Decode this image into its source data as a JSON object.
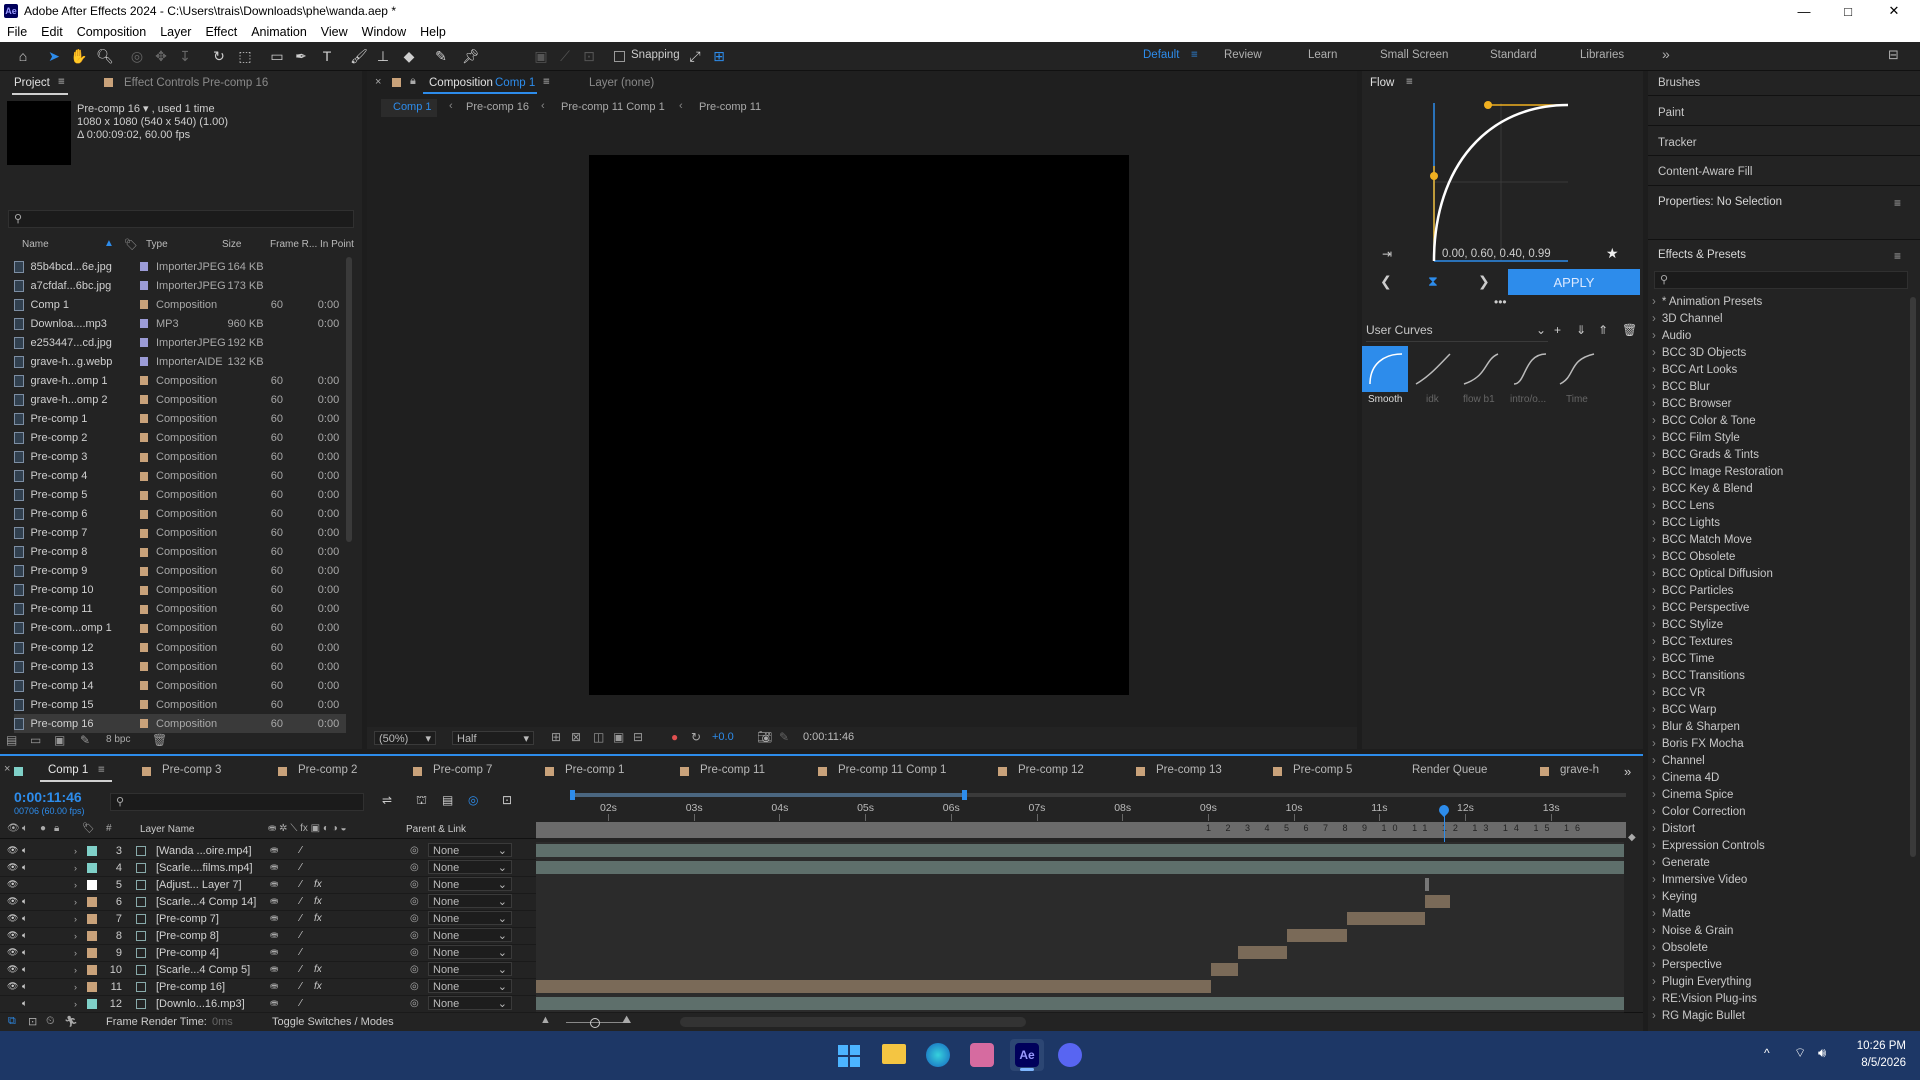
{
  "window": {
    "title": "Adobe After Effects 2024 - C:\\Users\\trais\\Downloads\\phe\\wanda.aep *",
    "controls": [
      "—",
      "□",
      "✕"
    ]
  },
  "menu": [
    "File",
    "Edit",
    "Composition",
    "Layer",
    "Effect",
    "Animation",
    "View",
    "Window",
    "Help"
  ],
  "toolbar": {
    "snapping_label": "Snapping",
    "workspaces": [
      "Default",
      "Review",
      "Learn",
      "Small Screen",
      "Standard",
      "Libraries"
    ],
    "active_workspace": "Default"
  },
  "project": {
    "tab": "Project",
    "effect_controls_tab": "Effect Controls Pre-comp 16",
    "info_name": "Pre-comp 16 ▾ , used 1 time",
    "info_dims": "1080 x 1080  (540 x 540) (1.00)",
    "info_dur": "Δ 0:00:09:02, 60.00 fps",
    "columns": [
      "Name",
      "Type",
      "Size",
      "Frame R...",
      "In Point"
    ],
    "rows": [
      {
        "name": "85b4bcd...6e.jpg",
        "type": "ImporterJPEG",
        "size": "164 KB",
        "fr": "",
        "ip": "",
        "color": "#9b9bd6"
      },
      {
        "name": "a7cfdaf...6bc.jpg",
        "type": "ImporterJPEG",
        "size": "173 KB",
        "fr": "",
        "ip": "",
        "color": "#9b9bd6"
      },
      {
        "name": "Comp 1",
        "type": "Composition",
        "size": "",
        "fr": "60",
        "ip": "0:00",
        "color": "#c9a27a"
      },
      {
        "name": "Downloa....mp3",
        "type": "MP3",
        "size": "960 KB",
        "fr": "",
        "ip": "0:00",
        "color": "#9b9bd6"
      },
      {
        "name": "e253447...cd.jpg",
        "type": "ImporterJPEG",
        "size": "192 KB",
        "fr": "",
        "ip": "",
        "color": "#9b9bd6"
      },
      {
        "name": "grave-h...g.webp",
        "type": "ImporterAIDE",
        "size": "132 KB",
        "fr": "",
        "ip": "",
        "color": "#9b9bd6"
      },
      {
        "name": "grave-h...omp 1",
        "type": "Composition",
        "size": "",
        "fr": "60",
        "ip": "0:00",
        "color": "#c9a27a"
      },
      {
        "name": "grave-h...omp 2",
        "type": "Composition",
        "size": "",
        "fr": "60",
        "ip": "0:00",
        "color": "#c9a27a"
      },
      {
        "name": "Pre-comp 1",
        "type": "Composition",
        "size": "",
        "fr": "60",
        "ip": "0:00",
        "color": "#c9a27a"
      },
      {
        "name": "Pre-comp 2",
        "type": "Composition",
        "size": "",
        "fr": "60",
        "ip": "0:00",
        "color": "#c9a27a"
      },
      {
        "name": "Pre-comp 3",
        "type": "Composition",
        "size": "",
        "fr": "60",
        "ip": "0:00",
        "color": "#c9a27a"
      },
      {
        "name": "Pre-comp 4",
        "type": "Composition",
        "size": "",
        "fr": "60",
        "ip": "0:00",
        "color": "#c9a27a"
      },
      {
        "name": "Pre-comp 5",
        "type": "Composition",
        "size": "",
        "fr": "60",
        "ip": "0:00",
        "color": "#c9a27a"
      },
      {
        "name": "Pre-comp 6",
        "type": "Composition",
        "size": "",
        "fr": "60",
        "ip": "0:00",
        "color": "#c9a27a"
      },
      {
        "name": "Pre-comp 7",
        "type": "Composition",
        "size": "",
        "fr": "60",
        "ip": "0:00",
        "color": "#c9a27a"
      },
      {
        "name": "Pre-comp 8",
        "type": "Composition",
        "size": "",
        "fr": "60",
        "ip": "0:00",
        "color": "#c9a27a"
      },
      {
        "name": "Pre-comp 9",
        "type": "Composition",
        "size": "",
        "fr": "60",
        "ip": "0:00",
        "color": "#c9a27a"
      },
      {
        "name": "Pre-comp 10",
        "type": "Composition",
        "size": "",
        "fr": "60",
        "ip": "0:00",
        "color": "#c9a27a"
      },
      {
        "name": "Pre-comp 11",
        "type": "Composition",
        "size": "",
        "fr": "60",
        "ip": "0:00",
        "color": "#c9a27a"
      },
      {
        "name": "Pre-com...omp 1",
        "type": "Composition",
        "size": "",
        "fr": "60",
        "ip": "0:00",
        "color": "#c9a27a"
      },
      {
        "name": "Pre-comp 12",
        "type": "Composition",
        "size": "",
        "fr": "60",
        "ip": "0:00",
        "color": "#c9a27a"
      },
      {
        "name": "Pre-comp 13",
        "type": "Composition",
        "size": "",
        "fr": "60",
        "ip": "0:00",
        "color": "#c9a27a"
      },
      {
        "name": "Pre-comp 14",
        "type": "Composition",
        "size": "",
        "fr": "60",
        "ip": "0:00",
        "color": "#c9a27a"
      },
      {
        "name": "Pre-comp 15",
        "type": "Composition",
        "size": "",
        "fr": "60",
        "ip": "0:00",
        "color": "#c9a27a"
      },
      {
        "name": "Pre-comp 16",
        "type": "Composition",
        "size": "",
        "fr": "60",
        "ip": "0:00",
        "color": "#c9a27a"
      }
    ],
    "bpc": "8 bpc"
  },
  "comp": {
    "tab_label": "Composition",
    "tab_comp": "Comp 1",
    "layer_tab": "Layer (none)",
    "breadcrumbs": [
      "Comp 1",
      "Pre-comp 16",
      "Pre-comp 11 Comp 1",
      "Pre-comp 11"
    ],
    "zoom": "(50%)",
    "resolution": "Half",
    "exposure": "+0.0",
    "timecode": "0:00:11:46"
  },
  "flow": {
    "title": "Flow",
    "values": "0.00, 0.60, 0.40, 0.99",
    "apply": "APPLY",
    "curves_select": "User Curves",
    "presets": [
      "Smooth",
      "idk",
      "flow b1",
      "intro/o...",
      "Time"
    ]
  },
  "right_panels": [
    "Brushes",
    "Paint",
    "Tracker",
    "Content-Aware Fill",
    "Properties: No Selection",
    "Effects & Presets"
  ],
  "effects": [
    "* Animation Presets",
    "3D Channel",
    "Audio",
    "BCC 3D Objects",
    "BCC Art Looks",
    "BCC Blur",
    "BCC Browser",
    "BCC Color & Tone",
    "BCC Film Style",
    "BCC Grads & Tints",
    "BCC Image Restoration",
    "BCC Key & Blend",
    "BCC Lens",
    "BCC Lights",
    "BCC Match Move",
    "BCC Obsolete",
    "BCC Optical Diffusion",
    "BCC Particles",
    "BCC Perspective",
    "BCC Stylize",
    "BCC Textures",
    "BCC Time",
    "BCC Transitions",
    "BCC VR",
    "BCC Warp",
    "Blur & Sharpen",
    "Boris FX Mocha",
    "Channel",
    "Cinema 4D",
    "Cinema Spice",
    "Color Correction",
    "Distort",
    "Expression Controls",
    "Generate",
    "Immersive Video",
    "Keying",
    "Matte",
    "Noise & Grain",
    "Obsolete",
    "Perspective",
    "Plugin Everything",
    "RE:Vision Plug-ins",
    "RG Magic Bullet"
  ],
  "timeline": {
    "tabs": [
      "Comp 1",
      "Pre-comp 3",
      "Pre-comp 2",
      "Pre-comp 7",
      "Pre-comp 1",
      "Pre-comp 11",
      "Pre-comp 11 Comp 1",
      "Pre-comp 12",
      "Pre-comp 13",
      "Pre-comp 5",
      "Render Queue",
      "grave-h"
    ],
    "timecode": "0:00:11:46",
    "frames": "00706 (60.00 fps)",
    "col_layer_name": "Layer Name",
    "col_parent": "Parent & Link",
    "ruler": [
      "02s",
      "03s",
      "04s",
      "05s",
      "06s",
      "07s",
      "08s",
      "09s",
      "10s",
      "11s",
      "12s",
      "13s"
    ],
    "layers": [
      {
        "num": "3",
        "name": "[Wanda ...oire.mp4]",
        "color": "#7fd0c8",
        "parent": "None",
        "fx": false,
        "bar": [
          0,
          1
        ]
      },
      {
        "num": "4",
        "name": "[Scarle....films.mp4]",
        "color": "#7fd0c8",
        "parent": "None",
        "fx": false,
        "bar": [
          0,
          1
        ]
      },
      {
        "num": "5",
        "name": "[Adjust... Layer 7]",
        "color": "#ffffff",
        "parent": "None",
        "fx": true,
        "bar": [
          0.817,
          0.821
        ]
      },
      {
        "num": "6",
        "name": "[Scarle...4 Comp 14]",
        "color": "#c9a27a",
        "parent": "None",
        "fx": true,
        "bar": [
          0.817,
          0.84
        ]
      },
      {
        "num": "7",
        "name": "[Pre-comp 7]",
        "color": "#c9a27a",
        "parent": "None",
        "fx": true,
        "bar": [
          0.745,
          0.817
        ]
      },
      {
        "num": "8",
        "name": "[Pre-comp 8]",
        "color": "#c9a27a",
        "parent": "None",
        "fx": false,
        "bar": [
          0.69,
          0.745
        ]
      },
      {
        "num": "9",
        "name": "[Pre-comp 4]",
        "color": "#c9a27a",
        "parent": "None",
        "fx": false,
        "bar": [
          0.645,
          0.69
        ]
      },
      {
        "num": "10",
        "name": "[Scarle...4 Comp 5]",
        "color": "#c9a27a",
        "parent": "None",
        "fx": true,
        "bar": [
          0.62,
          0.645
        ]
      },
      {
        "num": "11",
        "name": "[Pre-comp 16]",
        "color": "#c9a27a",
        "parent": "None",
        "fx": true,
        "bar": [
          0,
          0.62
        ]
      },
      {
        "num": "12",
        "name": "[Downlo...16.mp3]",
        "color": "#7fd0c8",
        "parent": "None",
        "fx": false,
        "bar": [
          0,
          1
        ]
      }
    ],
    "frame_render": "Frame Render Time:",
    "frame_render_val": "0ms",
    "toggle": "Toggle Switches / Modes",
    "playhead": 0.835
  },
  "taskbar": {
    "time": "10:26 PM",
    "date": "8/5/2026"
  }
}
